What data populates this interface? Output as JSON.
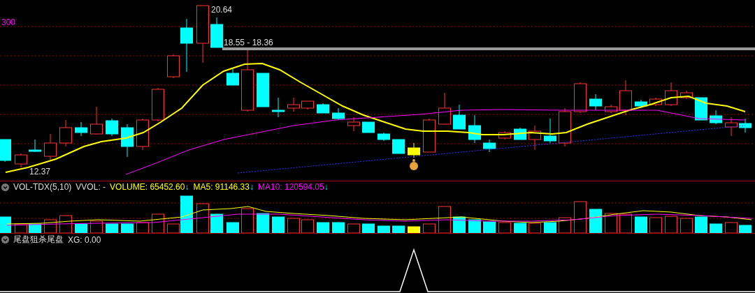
{
  "main_chart": {
    "axis_value": "300",
    "high_label": "20.64",
    "range_label": "18.55 - 18.36",
    "low_label": "12.37"
  },
  "volume_panel": {
    "name": "VOL-TDX(5,10)",
    "vvol": "VVOL: -",
    "readings": [
      {
        "label": "VOLUME: 65452.60",
        "color": "#ffff00",
        "arrow": "↓"
      },
      {
        "label": "MA5: 91146.33",
        "color": "#ffff00",
        "arrow": "↓"
      },
      {
        "label": "MA10: 120594.05",
        "color": "#ff00ff",
        "arrow": "↓"
      }
    ]
  },
  "indicator_panel": {
    "name": "尾盘狙杀尾盘",
    "reading": "XG: 0.00"
  }
}
